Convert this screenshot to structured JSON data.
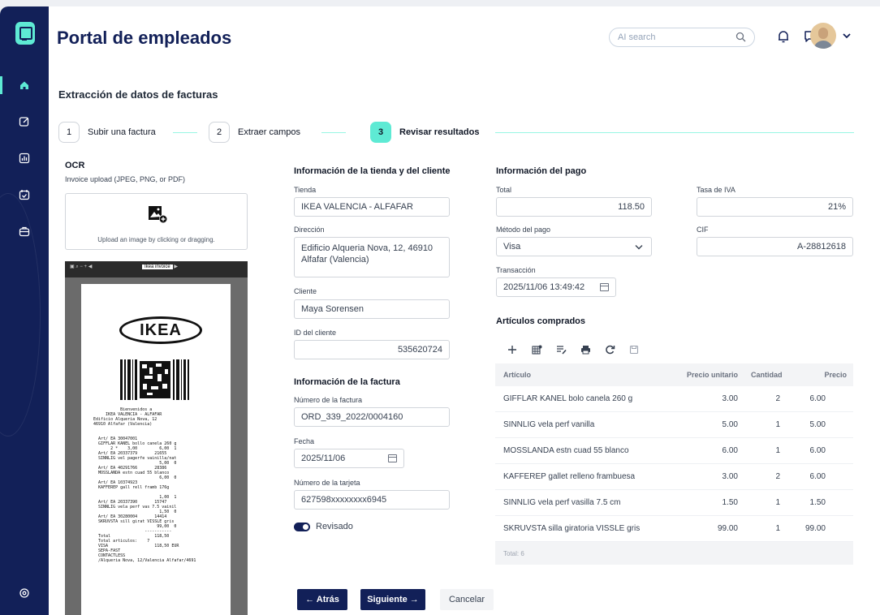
{
  "app": {
    "title": "Portal de empleados"
  },
  "search": {
    "placeholder": "AI search"
  },
  "page": {
    "section_title": "Extracción de datos de facturas"
  },
  "steps": [
    {
      "number": "1",
      "label": "Subir una factura"
    },
    {
      "number": "2",
      "label": "Extraer campos"
    },
    {
      "number": "3",
      "label": "Revisar resultados"
    }
  ],
  "ocr": {
    "title": "OCR",
    "subtitle": "Invoice upload (JPEG, PNG, or PDF)",
    "dropzone_text": "Upload an image by clicking or dragging.",
    "viewer_tab": "Ikea invoice",
    "logo_text": "IKEA",
    "receipt_text": "           Bienvenidos a\n     IKEA VALENCIA - ALFAFAR\nEdificio Alqueria Nova, 12\n46910 Alfafar (Valencia)\n\n\n  Art/ EA 30047001\n  GIFFLAR KANEL bollo canela 260 g\n       2 *    3,00         6,00  1\n  Art/ EA 20337379       21655\n  SINNLIG vel pagerfe vainilla/nat\n                           5,00  0\n  Art/ EA 40291766       28386\n  MOSSLANDA estn cuad 55 blanco\n                           6,00  0\n  Art/ EA 10374923\n  KAFFEREP gall rell framb 176g\n\n                           1,00  1\n  Art/ EA 20337390       15747\n  SINNLIG vela perf vas 7.5 vainil\n                           1,50  0\n  Art/ EA 30280004       14414\n  SKRUVSTA sill girat VISSLE gris\n                          99,00  0\n                     -----------\n  Total                  118,50\n  Total articulos:    7\n  VISA                   118,50 EUR\n  SEPA-FAST\n  CONTACTLESS\n  /Alqueria Nova, 12/Valencia Alfafar/4691"
  },
  "store": {
    "title": "Información de la tienda y del cliente",
    "tienda_label": "Tienda",
    "tienda_value": "IKEA VALENCIA - ALFAFAR",
    "direccion_label": "Dirección",
    "direccion_value": "Edificio Alqueria Nova, 12, 46910 Alfafar (Valencia)",
    "cliente_label": "Cliente",
    "cliente_value": "Maya Sorensen",
    "id_label": "ID del cliente",
    "id_value": "535620724"
  },
  "invoice": {
    "title": "Información de la factura",
    "numero_label": "Número de la factura",
    "numero_value": "ORD_339_2022/0004160",
    "fecha_label": "Fecha",
    "fecha_value": "2025/11/06",
    "tarjeta_label": "Número de la tarjeta",
    "tarjeta_value": "627598xxxxxxxx6945",
    "revisado_label": "Revisado",
    "revisado_on": true
  },
  "payment": {
    "title": "Información del pago",
    "total_label": "Total",
    "total_value": "118.50",
    "iva_label": "Tasa de IVA",
    "iva_value": "21%",
    "metodo_label": "Método del pago",
    "metodo_value": "Visa",
    "cif_label": "CIF",
    "cif_value": "A-28812618",
    "transaccion_label": "Transacción",
    "transaccion_value": "2025/11/06 13:49:42"
  },
  "articles": {
    "title": "Artículos comprados",
    "toolbar_icons": [
      "add-icon",
      "add-column-icon",
      "edit-rows-icon",
      "print-icon",
      "refresh-icon",
      "save-icon"
    ],
    "headers": [
      "Artículo",
      "Precio unitario",
      "Cantidad",
      "Precio"
    ],
    "rows": [
      [
        "GIFFLAR KANEL bolo canela 260 g",
        "3.00",
        "2",
        "6.00"
      ],
      [
        "SINNLIG vela perf vanilla",
        "5.00",
        "1",
        "5.00"
      ],
      [
        "MOSSLANDA estn cuad 55 blanco",
        "6.00",
        "1",
        "6.00"
      ],
      [
        "KAFFEREP gallet relleno frambuesa",
        "3.00",
        "2",
        "6.00"
      ],
      [
        "SINNLIG vela perf vasilla 7.5 cm",
        "1.50",
        "1",
        "1.50"
      ],
      [
        "SKRUVSTA silla giratoria VISSLE gris",
        "99.00",
        "1",
        "99.00"
      ]
    ],
    "footer": "Total: 6"
  },
  "actions": {
    "back": "← Atrás",
    "next": "Siguiente →",
    "cancel": "Cancelar"
  },
  "colors": {
    "brand": "#122058",
    "accent": "#5eead4"
  }
}
